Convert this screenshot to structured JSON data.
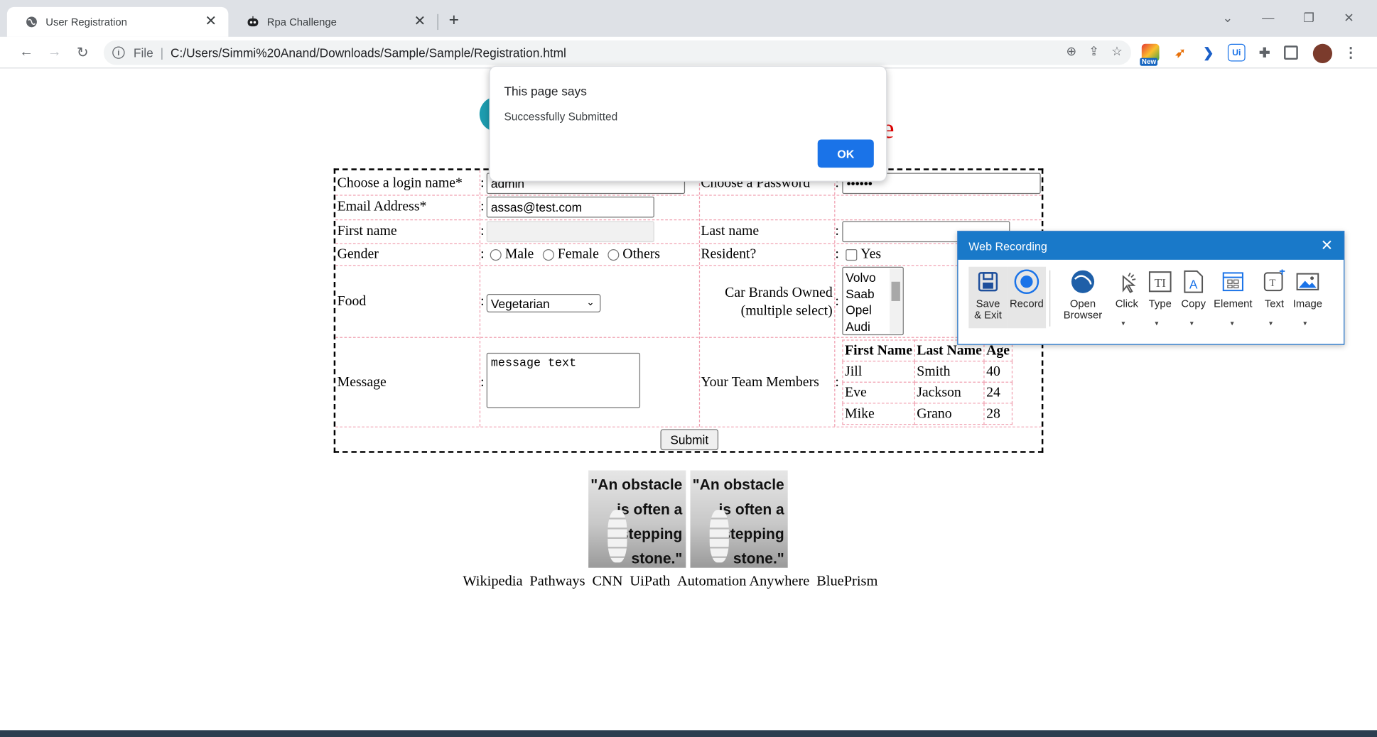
{
  "browser": {
    "tabs": [
      {
        "label": "User Registration",
        "active": true,
        "icon": "globe-icon"
      },
      {
        "label": "Rpa Challenge",
        "active": false,
        "icon": "robot-icon"
      }
    ],
    "address": {
      "scheme_label": "File",
      "url": "C:/Users/Simmi%20Anand/Downloads/Sample/Sample/Registration.html"
    },
    "new_badge": "New",
    "ext_ui_label": "Ui"
  },
  "page": {
    "form": {
      "login_label": "Choose a login name*",
      "login_value": "admin",
      "password_label": "Choose a Password",
      "password_value": "••••••",
      "email_label": "Email Address*",
      "email_value": "assas@test.com",
      "firstname_label": "First name",
      "lastname_label": "Last name",
      "gender_label": "Gender",
      "gender_options": [
        "Male",
        "Female",
        "Others"
      ],
      "resident_label": "Resident?",
      "resident_option": "Yes",
      "food_label": "Food",
      "food_value": "Vegetarian",
      "cars_label_1": "Car Brands Owned",
      "cars_label_2": "(multiple select)",
      "cars_options": [
        "Volvo",
        "Saab",
        "Opel",
        "Audi"
      ],
      "message_label": "Message",
      "message_value": "message text",
      "team_label": "Your Team Members",
      "team_headers": [
        "First Name",
        "Last Name",
        "Age"
      ],
      "team_rows": [
        [
          "Jill",
          "Smith",
          "40"
        ],
        [
          "Eve",
          "Jackson",
          "24"
        ],
        [
          "Mike",
          "Grano",
          "28"
        ]
      ],
      "colon": ":",
      "submit_label": "Submit"
    },
    "logo_letter": "e",
    "quote_lines": [
      "\"An obstacle",
      "is often a",
      "stepping",
      "stone.\""
    ],
    "links": [
      "Wikipedia",
      "Pathways",
      "CNN",
      "UiPath",
      "Automation Anywhere",
      "BluePrism"
    ]
  },
  "alert": {
    "title": "This page says",
    "message": "Successfully Submitted",
    "ok_label": "OK"
  },
  "web_recording": {
    "title": "Web Recording",
    "tools": [
      {
        "label": "Save\n& Exit",
        "icon": "save-icon"
      },
      {
        "label": "Record",
        "icon": "record-icon"
      },
      {
        "label": "Open\nBrowser",
        "icon": "open-browser-icon"
      },
      {
        "label": "Click",
        "icon": "click-icon"
      },
      {
        "label": "Type",
        "icon": "type-icon"
      },
      {
        "label": "Copy",
        "icon": "copy-icon"
      },
      {
        "label": "Element",
        "icon": "element-icon"
      },
      {
        "label": "Text",
        "icon": "text-icon"
      },
      {
        "label": "Image",
        "icon": "image-icon"
      }
    ]
  }
}
